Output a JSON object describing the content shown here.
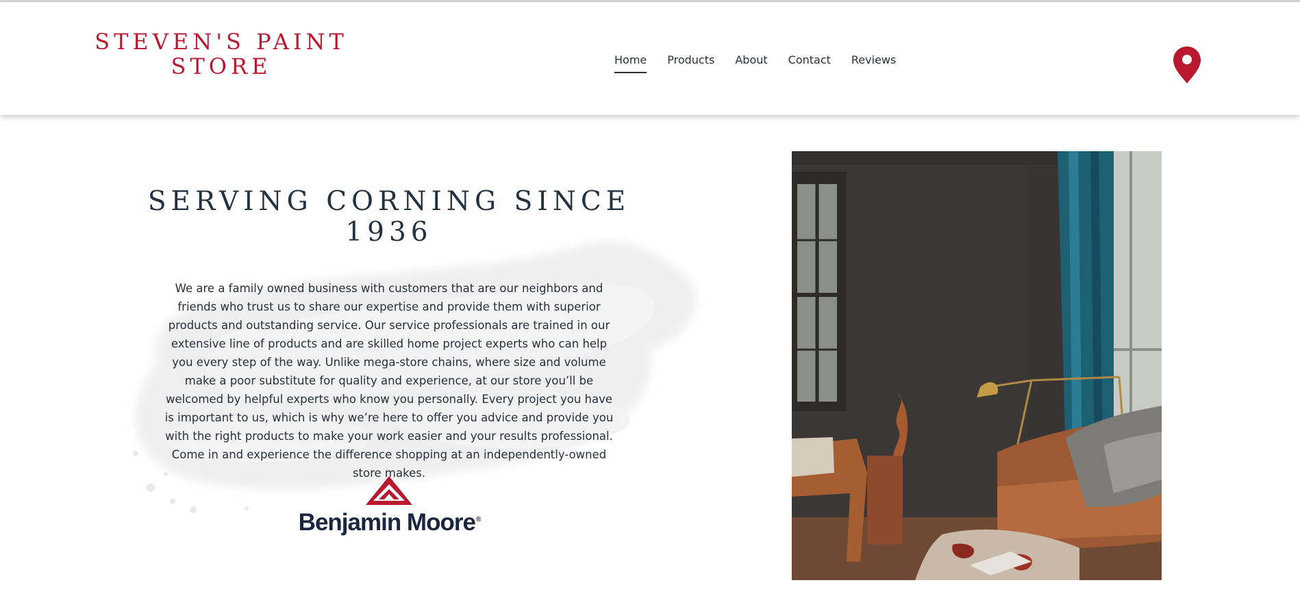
{
  "header": {
    "store_name": "STEVEN'S PAINT STORE",
    "nav": [
      {
        "label": "Home",
        "active": true
      },
      {
        "label": "Products",
        "active": false
      },
      {
        "label": "About",
        "active": false
      },
      {
        "label": "Contact",
        "active": false
      },
      {
        "label": "Reviews",
        "active": false
      }
    ],
    "location_icon": "map-pin-icon"
  },
  "hero": {
    "title": "SERVING CORNING SINCE 1936",
    "body": "We are a family owned business with customers that are our neighbors and friends who trust us to share our expertise and provide them with superior products and outstanding service. Our service professionals are trained in our extensive line of products and are skilled home project experts who can help you every step of the way. Unlike mega-store chains, where size and volume make a poor substitute for quality and experience, at our store you’ll be welcomed by helpful experts who know you personally. Every project you have is important to us, which is why we’re here to offer you advice and provide you with the right products to make your work easier and your results professional. Come in and experience the difference shopping at an independently-owned store makes.",
    "brand_logo_text": "Benjamin Moore",
    "brand_logo_mark": "®"
  },
  "colors": {
    "brand_red": "#b8192f",
    "heading": "#233241",
    "text": "#2a2f3a",
    "brand_navy": "#1c2540"
  }
}
